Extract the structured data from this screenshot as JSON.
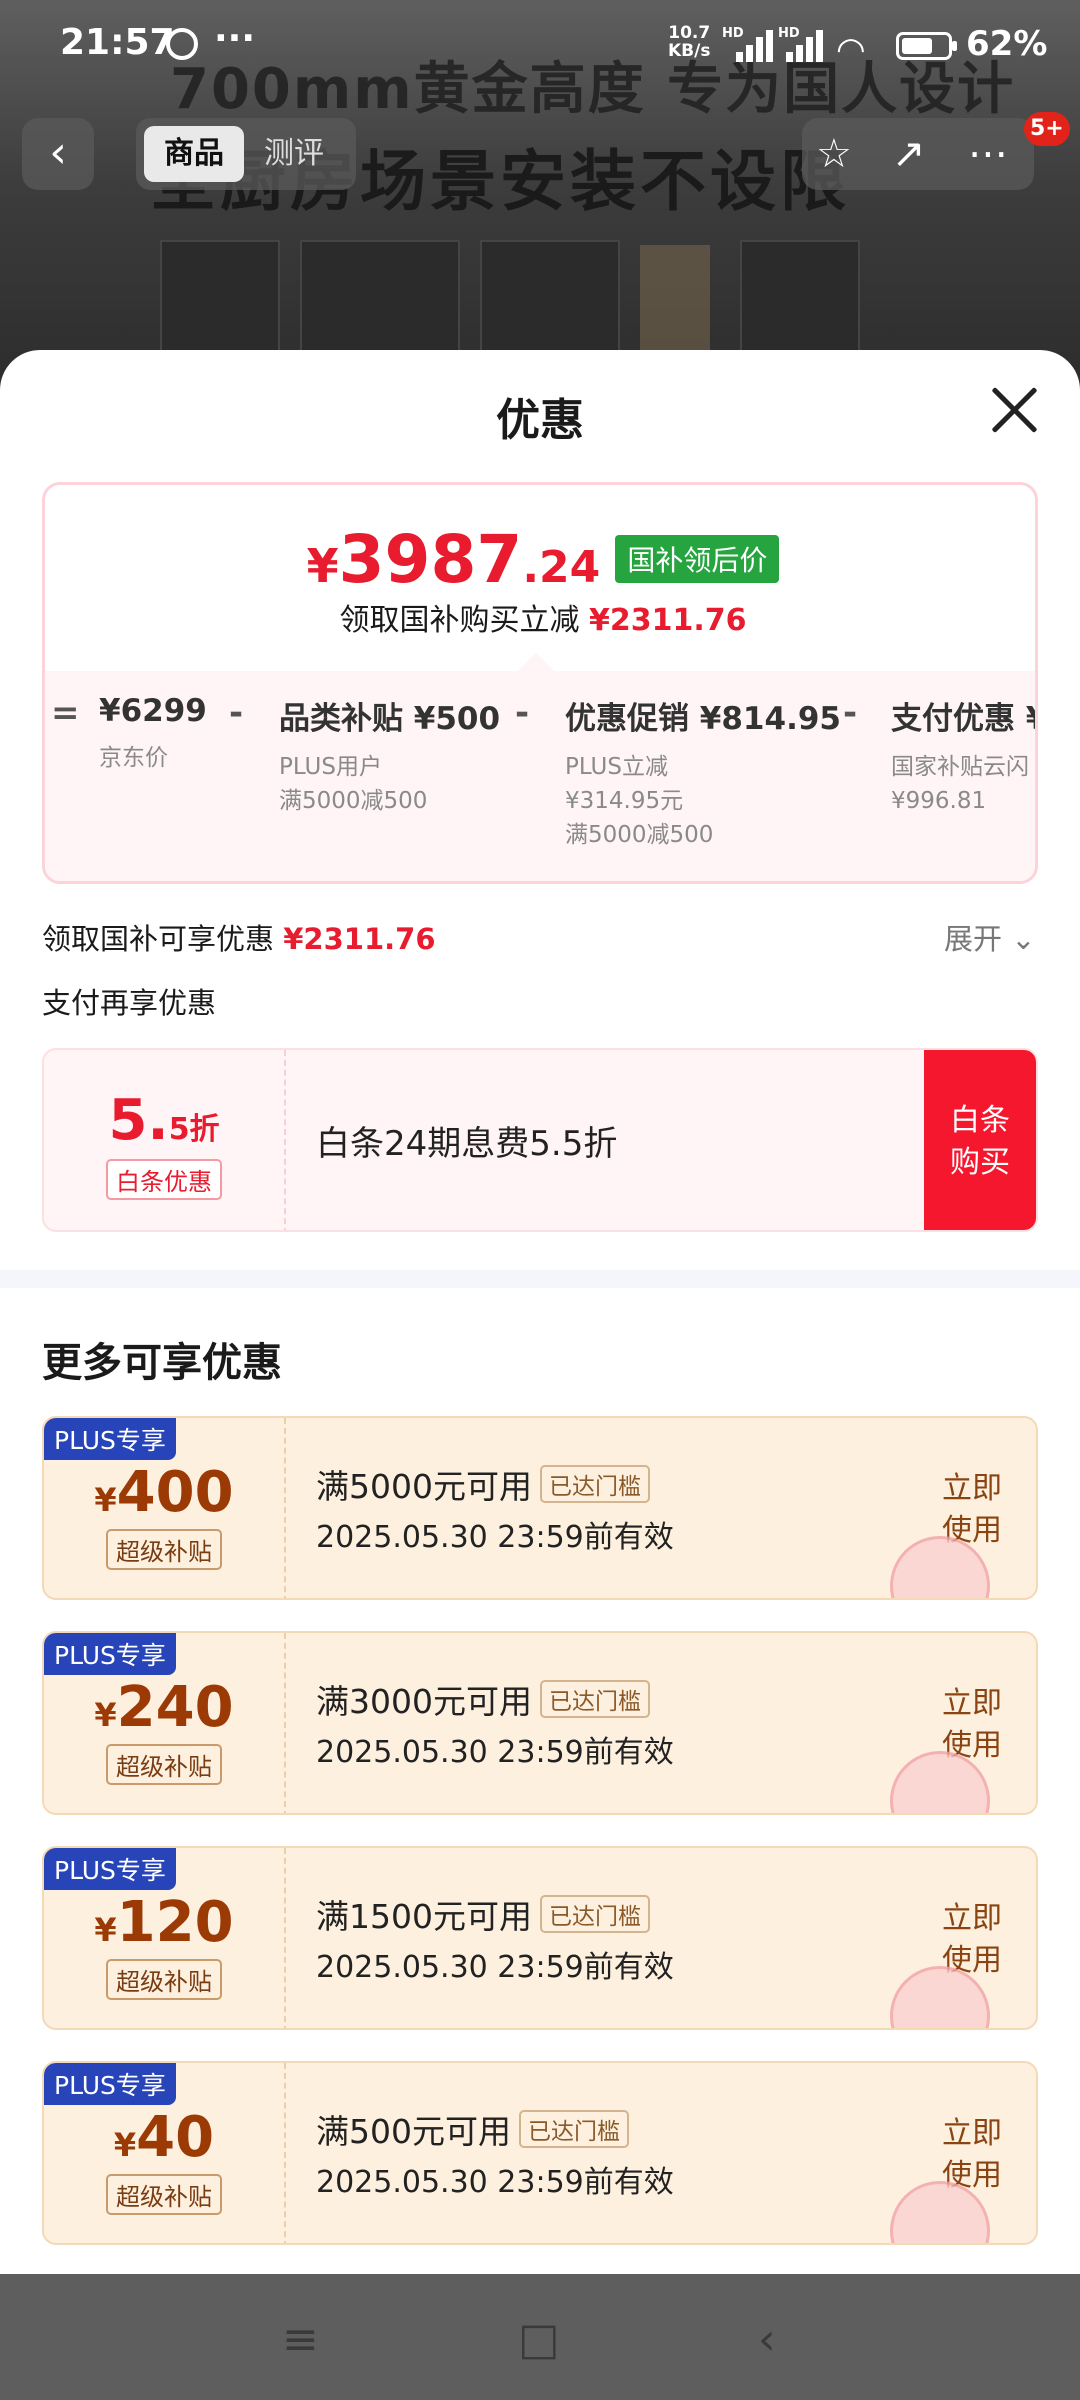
{
  "status_bar": {
    "time": "21:57",
    "more": "···",
    "speed_value": "10.7",
    "speed_unit": "KB/s",
    "hd1": "HD",
    "hd2": "HD",
    "battery": "62%"
  },
  "background": {
    "ad_line1": "700mm黄金高度 专为国人设计",
    "ad_line2": "全厨房场景安装不设限",
    "badge": "5+"
  },
  "nav": {
    "tab_goods": "商品",
    "tab_review": "测评"
  },
  "sheet": {
    "title": "优惠",
    "final_price_yen": "¥",
    "final_price_int": "3987",
    "final_price_dec": ".24",
    "final_price_tag": "国补领后价",
    "subline_text": "领取国补购买立减",
    "subline_amount": "¥2311.76",
    "calc": {
      "eq": "=",
      "minus": "-",
      "items": [
        {
          "title": "¥6299",
          "lines": [
            "京东价"
          ]
        },
        {
          "title": "品类补贴 ¥500",
          "lines": [
            "PLUS用户",
            "满5000减500"
          ]
        },
        {
          "title": "优惠促销 ¥814.95",
          "lines": [
            "PLUS立减",
            "¥314.95元",
            "满5000减500"
          ]
        },
        {
          "title": "支付优惠 ¥",
          "lines": [
            "国家补贴云闪",
            "¥996.81"
          ]
        }
      ]
    },
    "gov_subsidy_label": "领取国补可享优惠",
    "gov_subsidy_amount": "¥2311.76",
    "expand_label": "展开",
    "pay_more_label": "支付再享优惠",
    "baitiao": {
      "discount_num": "5.",
      "discount_unit": "5折",
      "discount_label": "白条优惠",
      "description": "白条24期息费5.5折",
      "buy_line1": "白条",
      "buy_line2": "购买"
    },
    "more_title": "更多可享优惠",
    "coupons": [
      {
        "badge": "PLUS专享",
        "yen": "¥",
        "amount": "400",
        "sub": "超级补贴",
        "condition": "满5000元可用",
        "gate": "已达门槛",
        "expiry": "2025.05.30 23:59前有效",
        "use1": "立即",
        "use2": "使用"
      },
      {
        "badge": "PLUS专享",
        "yen": "¥",
        "amount": "240",
        "sub": "超级补贴",
        "condition": "满3000元可用",
        "gate": "已达门槛",
        "expiry": "2025.05.30 23:59前有效",
        "use1": "立即",
        "use2": "使用"
      },
      {
        "badge": "PLUS专享",
        "yen": "¥",
        "amount": "120",
        "sub": "超级补贴",
        "condition": "满1500元可用",
        "gate": "已达门槛",
        "expiry": "2025.05.30 23:59前有效",
        "use1": "立即",
        "use2": "使用"
      },
      {
        "badge": "PLUS专享",
        "yen": "¥",
        "amount": "40",
        "sub": "超级补贴",
        "condition": "满500元可用",
        "gate": "已达门槛",
        "expiry": "2025.05.30 23:59前有效",
        "use1": "立即",
        "use2": "使用"
      }
    ]
  },
  "colors": {
    "accent_red": "#e81c2e",
    "green_tag": "#26a43f",
    "plus_blue": "#2744b8",
    "coupon_bg": "#fdf0df"
  }
}
